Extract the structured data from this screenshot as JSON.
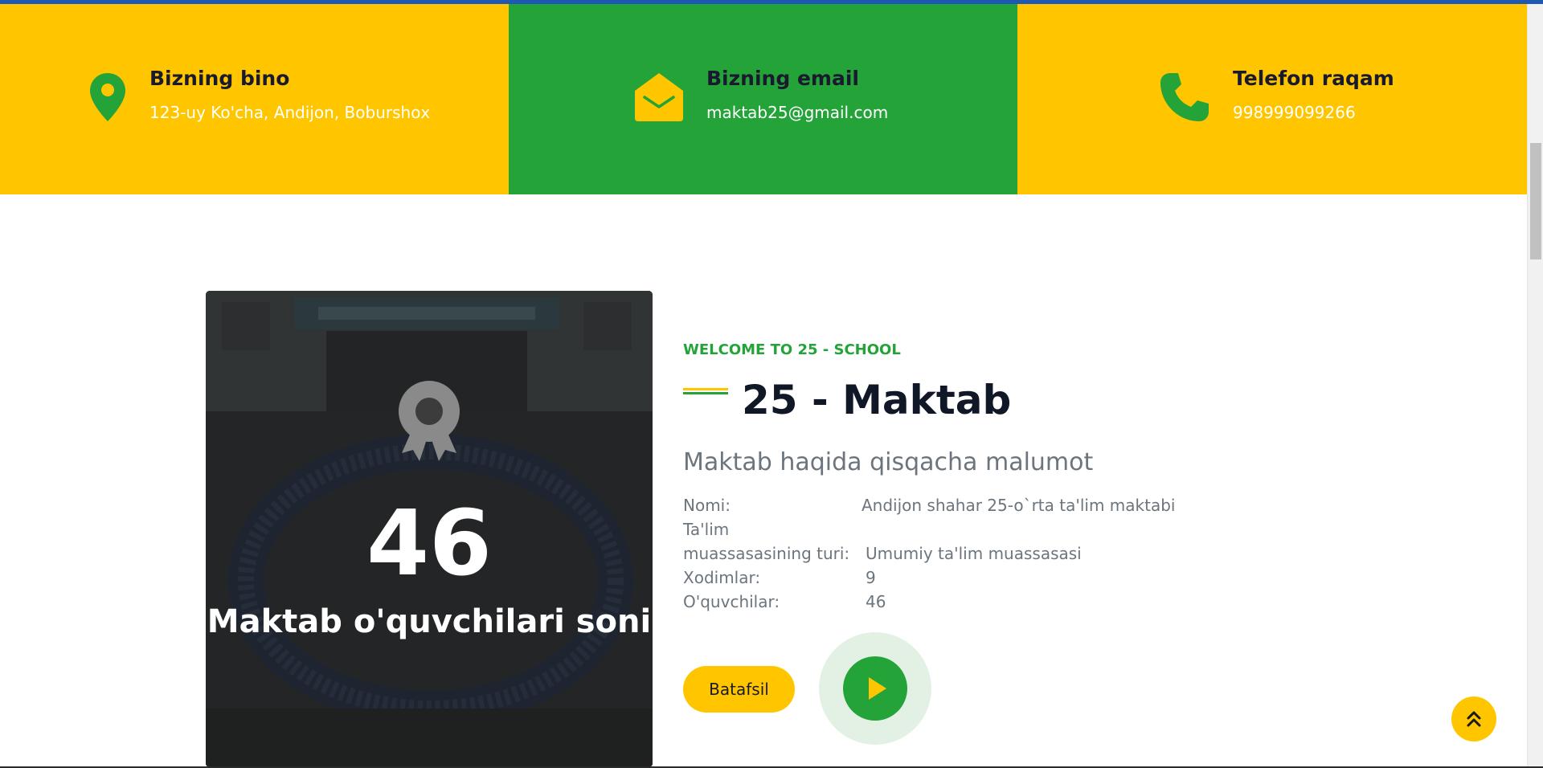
{
  "contact": [
    {
      "icon": "map-pin-icon",
      "title": "Bizning bino",
      "value": "123-uy Ko'cha, Andijon, Boburshoх"
    },
    {
      "icon": "envelope-icon",
      "title": "Bizning email",
      "value": "maktab25@gmail.com"
    },
    {
      "icon": "phone-icon",
      "title": "Telefon raqam",
      "value": "998999099266"
    }
  ],
  "stats": {
    "icon": "award-icon",
    "number": "46",
    "label": "Maktab o'quvchilari soni"
  },
  "about": {
    "welcome": "WELCOME TO 25 - SCHOOL",
    "title": "25 - Maktab",
    "subtitle": "Maktab haqida qisqacha malumot",
    "info": [
      {
        "label": "Nomi:",
        "value": "Andijon shahar 25-o`rta ta'lim maktabi"
      },
      {
        "label": "Ta'lim",
        "value": ""
      },
      {
        "label": "muassasasining turi:",
        "value": "Umumiy ta'lim muassasasi"
      },
      {
        "label": "Xodimlar:",
        "value": "9"
      },
      {
        "label": "O'quvchilar:",
        "value": "46"
      }
    ],
    "button_label": "Batafsil",
    "play_icon": "play-icon"
  },
  "scroll_top_icon": "chevron-double-up-icon",
  "colors": {
    "yellow": "#ffc600",
    "green": "#24a339",
    "dark": "#101828",
    "muted": "#6c757d"
  }
}
